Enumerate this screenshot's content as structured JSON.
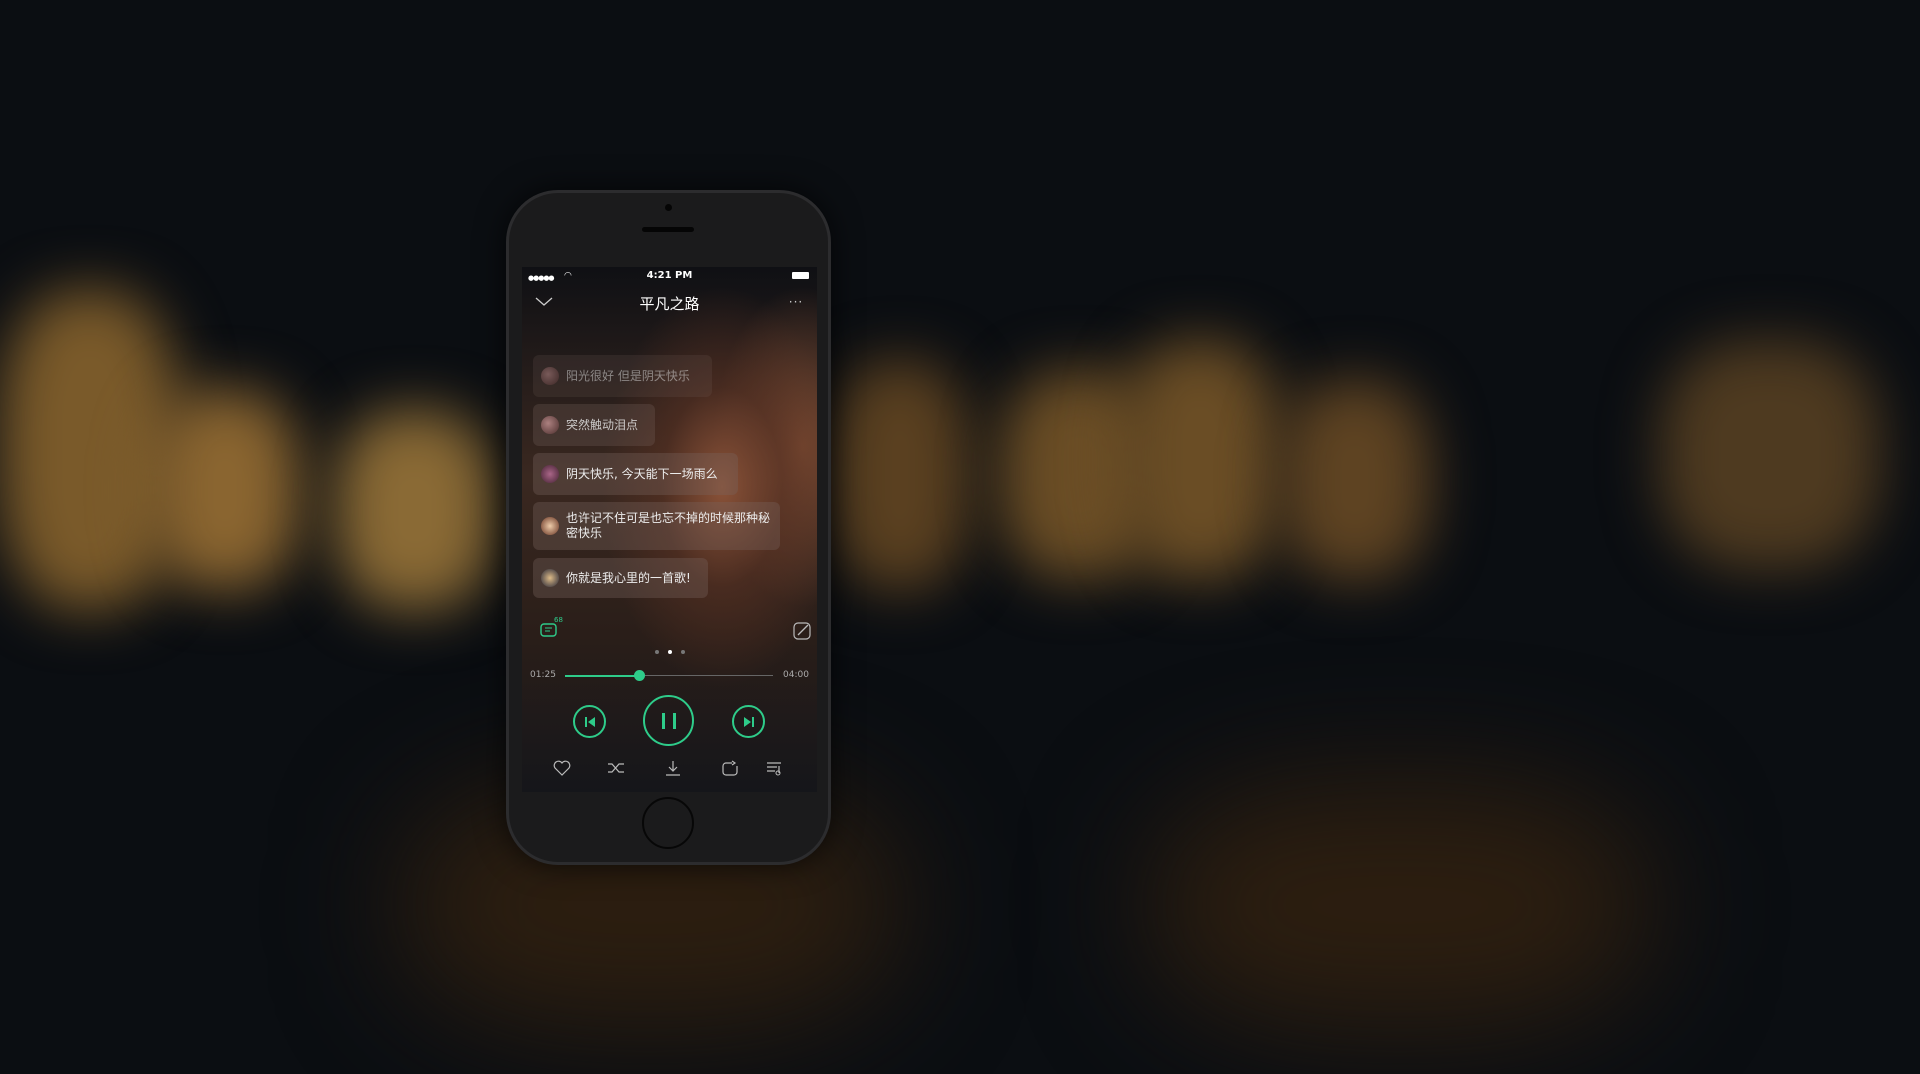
{
  "status_bar": {
    "time": "4:21 PM"
  },
  "header": {
    "title": "平凡之路"
  },
  "comments": [
    {
      "text": "阳光很好  但是阴天快乐"
    },
    {
      "text": "突然触动泪点"
    },
    {
      "text": "阴天快乐, 今天能下一场雨么"
    },
    {
      "text": "也许记不住可是也忘不掉的时候那种秘密快乐"
    },
    {
      "text": "你就是我心里的一首歌!"
    }
  ],
  "comment_count": "68",
  "player": {
    "elapsed": "01:25",
    "duration": "04:00",
    "progress": 0.354,
    "page_index": 1,
    "page_count": 3
  },
  "colors": {
    "accent": "#2ecc8a"
  }
}
